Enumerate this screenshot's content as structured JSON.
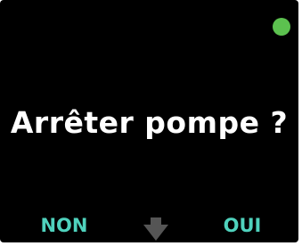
{
  "prompt": {
    "text": "Arrêter pompe ?"
  },
  "status_indicator": {
    "color": "#5cc14f",
    "icon": "status-dot-icon"
  },
  "actions": {
    "no_label": "NON",
    "yes_label": "OUI",
    "scroll_icon": "arrow-down-icon"
  },
  "colors": {
    "background": "#000000",
    "text": "#ffffff",
    "action": "#4fd2bd",
    "arrow": "#555555"
  }
}
